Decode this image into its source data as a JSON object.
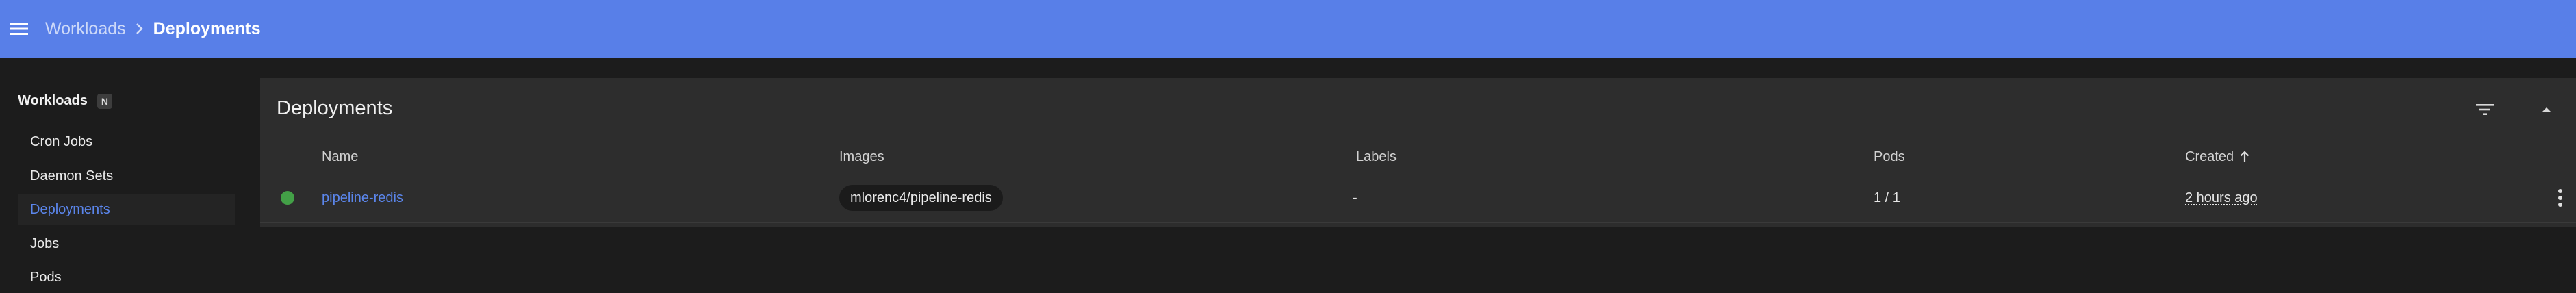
{
  "header": {
    "parent_crumb": "Workloads",
    "current_crumb": "Deployments",
    "menu_icon": "menu-icon",
    "separator_icon": "chevron-right-icon",
    "accent_color": "#587fe8"
  },
  "sidebar": {
    "section_title": "Workloads",
    "section_badge": "N",
    "items": [
      {
        "label": "Cron Jobs",
        "active": false
      },
      {
        "label": "Daemon Sets",
        "active": false
      },
      {
        "label": "Deployments",
        "active": true
      },
      {
        "label": "Jobs",
        "active": false
      },
      {
        "label": "Pods",
        "active": false
      }
    ]
  },
  "card": {
    "title": "Deployments",
    "filter_icon": "filter-icon",
    "collapse_icon": "arrow-up-icon",
    "columns": {
      "name": "Name",
      "images": "Images",
      "labels": "Labels",
      "pods": "Pods",
      "created": "Created",
      "sort_icon": "arrow-upward-icon"
    },
    "rows": [
      {
        "status": "running",
        "status_color": "#43a047",
        "name": "pipeline-redis",
        "image": "mlorenc4/pipeline-redis",
        "labels": "-",
        "pods": "1 / 1",
        "created": "2 hours ago",
        "actions_icon": "more-vertical-icon"
      }
    ]
  }
}
